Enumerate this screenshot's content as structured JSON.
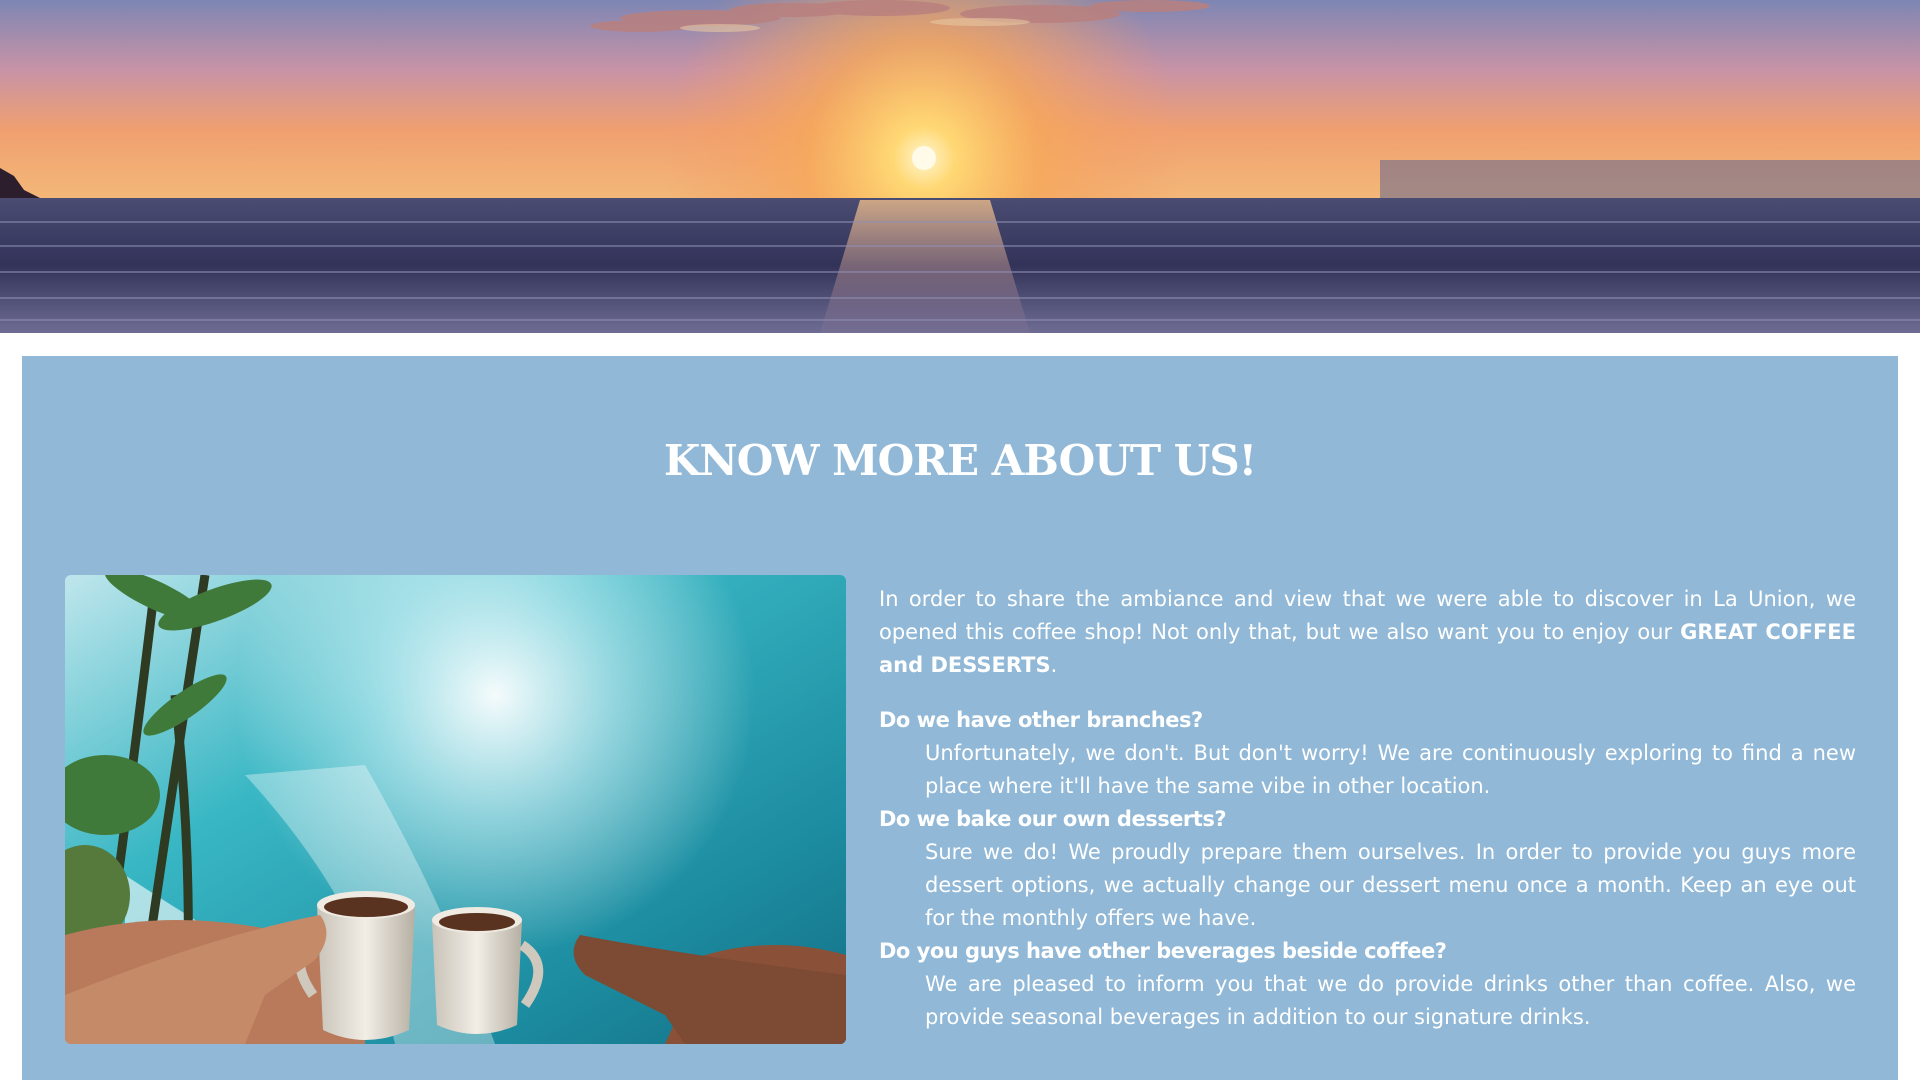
{
  "about": {
    "title": "KNOW MORE ABOUT US!",
    "intro_text": "In order to share the ambiance and view that we were able to discover in La Union, we opened this coffee shop! Not only that, but we also want you to enjoy our ",
    "intro_highlight": "GREAT COFFEE and DESSERTS",
    "intro_end": ".",
    "faqs": [
      {
        "question": "Do we have other branches?",
        "answer": "Unfortunately, we don't. But don't worry! We are continuously exploring to find a new place where it'll have the same vibe in other location."
      },
      {
        "question": "Do we bake our own desserts?",
        "answer": "Sure we do! We proudly prepare them ourselves. In order to provide you guys more dessert options, we actually change our dessert menu once a month. Keep an eye out for the monthly offers we have."
      },
      {
        "question": "Do you guys have other beverages beside coffee?",
        "answer": "We are pleased to inform you that we do provide drinks other than coffee. Also, we provide seasonal beverages in addition to our signature drinks."
      }
    ]
  },
  "colors": {
    "section_background": "#91b8d6",
    "text": "#ffffff"
  }
}
